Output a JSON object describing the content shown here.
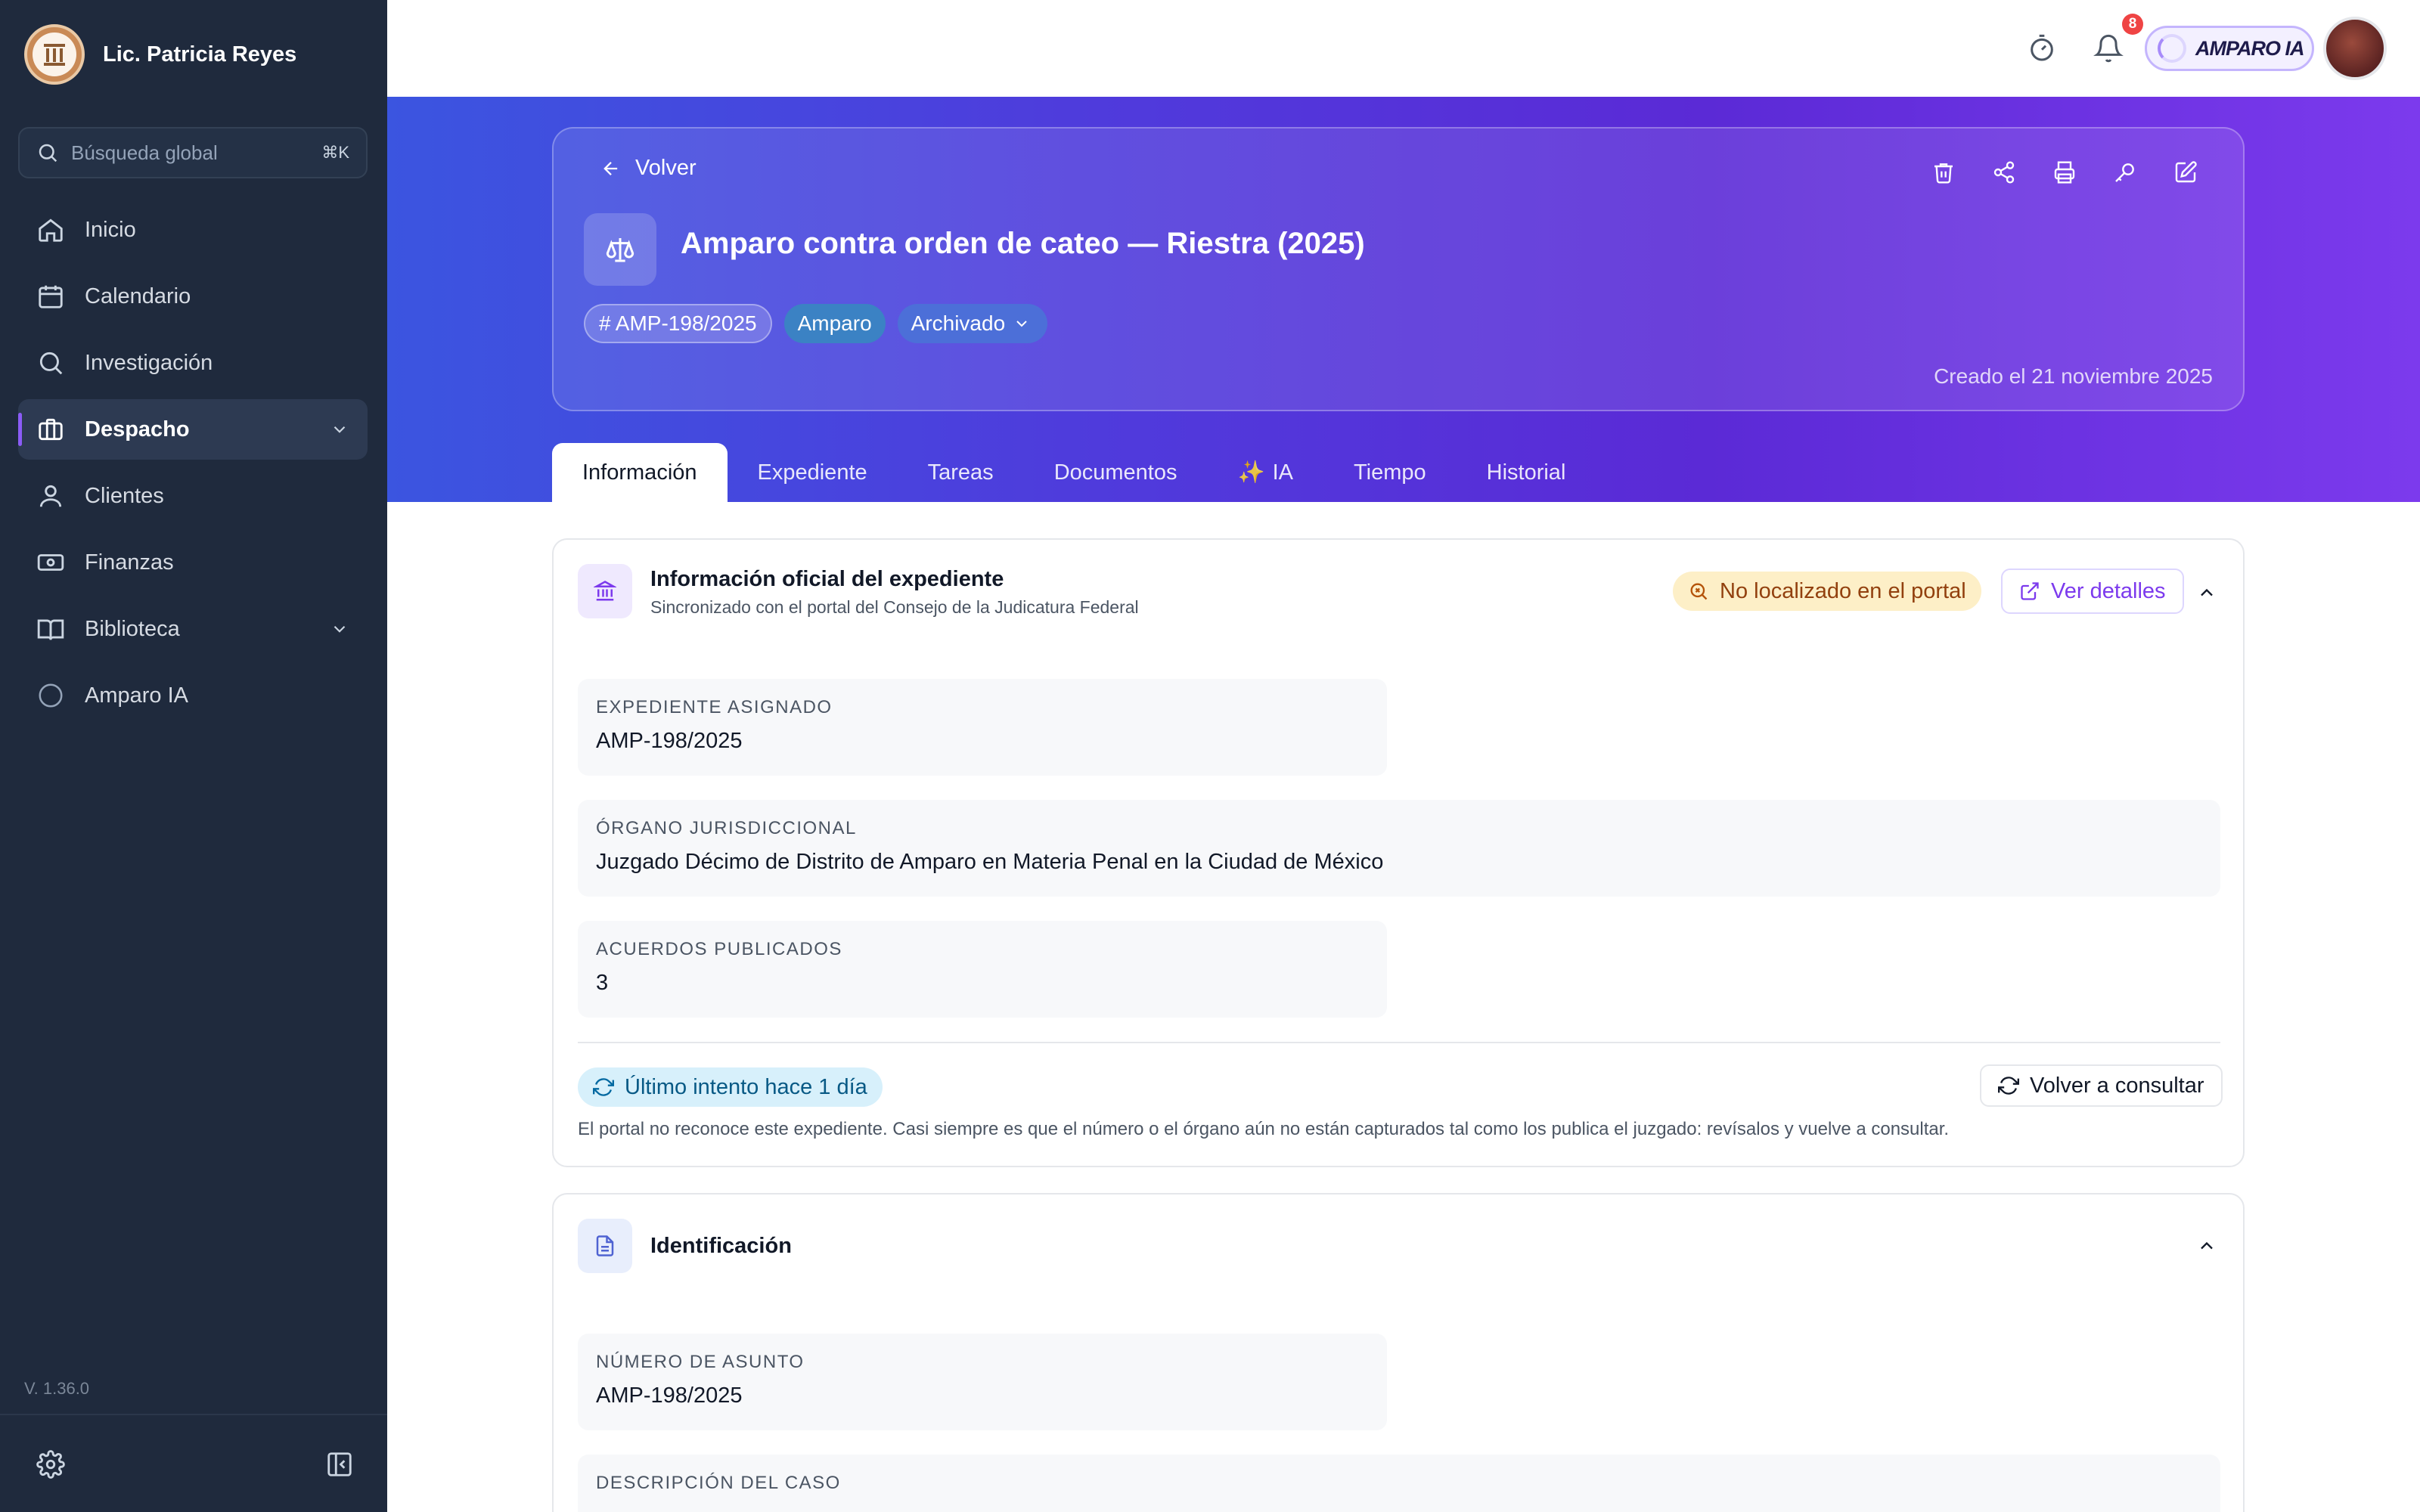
{
  "sidebar": {
    "user_name": "Lic. Patricia Reyes",
    "search_placeholder": "Búsqueda global",
    "search_shortcut": "⌘K",
    "items": [
      {
        "label": "Inicio",
        "icon": "home-icon"
      },
      {
        "label": "Calendario",
        "icon": "calendar-icon"
      },
      {
        "label": "Investigación",
        "icon": "search-icon"
      },
      {
        "label": "Despacho",
        "icon": "briefcase-icon",
        "active": true
      },
      {
        "label": "Clientes",
        "icon": "user-icon"
      },
      {
        "label": "Finanzas",
        "icon": "banknote-icon"
      },
      {
        "label": "Biblioteca",
        "icon": "book-icon"
      },
      {
        "label": "Amparo IA",
        "icon": "circle-icon"
      }
    ],
    "version": "V. 1.36.0"
  },
  "topbar": {
    "notification_count": "8",
    "ai_label": "AMPARO IA"
  },
  "case": {
    "back_label": "Volver",
    "title": "Amparo contra orden de cateo — Riestra (2025)",
    "id_chip": "# AMP-198/2025",
    "type_chip": "Amparo",
    "status_chip": "Archivado",
    "created": "Creado el 21 noviembre 2025"
  },
  "tabs": [
    {
      "label": "Información",
      "active": true
    },
    {
      "label": "Expediente"
    },
    {
      "label": "Tareas"
    },
    {
      "label": "Documentos"
    },
    {
      "label": "IA",
      "prefix": "✨"
    },
    {
      "label": "Tiempo"
    },
    {
      "label": "Historial"
    }
  ],
  "official_card": {
    "title": "Información oficial del expediente",
    "subtitle": "Sincronizado con el portal del Consejo de la Judicatura Federal",
    "status": "No localizado en el portal",
    "details_button": "Ver detalles",
    "fields": [
      {
        "label": "EXPEDIENTE ASIGNADO",
        "value": "AMP-198/2025"
      },
      {
        "label": "ÓRGANO JURISDICCIONAL",
        "value": "Juzgado Décimo de Distrito de Amparo en Materia Penal en la Ciudad de México"
      },
      {
        "label": "ACUERDOS PUBLICADOS",
        "value": "3"
      }
    ],
    "last_attempt": "Último intento hace 1 día",
    "retry_button": "Volver a consultar",
    "note": "El portal no reconoce este expediente. Casi siempre es que el número o el órgano aún no están capturados tal como los publica el juzgado: revísalos y vuelve a consultar."
  },
  "ident_card": {
    "title": "Identificación",
    "fields": [
      {
        "label": "NÚMERO DE ASUNTO",
        "value": "AMP-198/2025"
      },
      {
        "label": "DESCRIPCIÓN DEL CASO",
        "value": ""
      }
    ]
  },
  "colors": {
    "sidebar_bg": "#1f2a3d",
    "accent": "#7c3aed",
    "hero_start": "#3b55e0",
    "hero_end": "#7c3aed",
    "warning_bg": "#fdefc7",
    "info_bg": "#d7f0fb"
  }
}
